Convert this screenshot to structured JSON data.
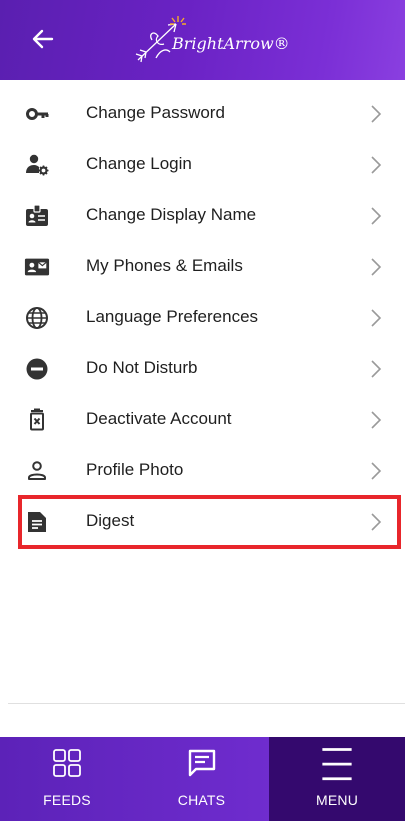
{
  "header": {
    "logo_text": "BrightArrow®"
  },
  "menu": {
    "items": [
      {
        "label": "Change Password",
        "icon": "key-icon"
      },
      {
        "label": "Change Login",
        "icon": "user-gear-icon"
      },
      {
        "label": "Change Display Name",
        "icon": "id-badge-icon"
      },
      {
        "label": "My Phones & Emails",
        "icon": "contact-card-icon"
      },
      {
        "label": "Language Preferences",
        "icon": "globe-icon"
      },
      {
        "label": "Do Not Disturb",
        "icon": "do-not-disturb-icon"
      },
      {
        "label": "Deactivate Account",
        "icon": "delete-bin-icon"
      },
      {
        "label": "Profile Photo",
        "icon": "person-outline-icon"
      },
      {
        "label": "Digest",
        "icon": "document-icon"
      }
    ]
  },
  "bottom_nav": {
    "feeds_label": "FEEDS",
    "chats_label": "CHATS",
    "menu_label": "MENU"
  },
  "colors": {
    "header_purple": "#6a22c4",
    "active_tab": "#34096e",
    "highlight": "#e8262b"
  }
}
